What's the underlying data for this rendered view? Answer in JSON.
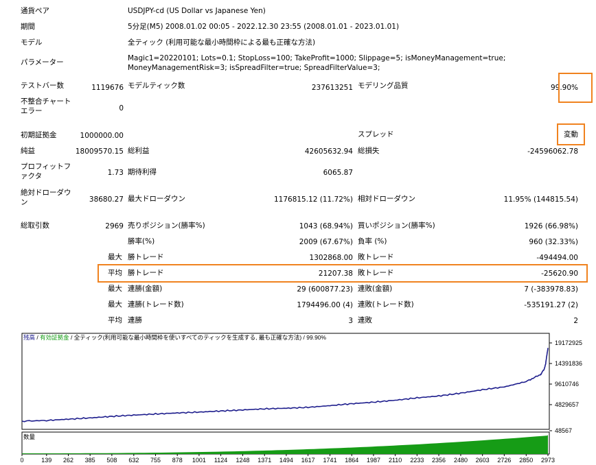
{
  "report": {
    "symbol_label": "通貨ペア",
    "symbol_value": "USDJPY-cd (US Dollar vs Japanese Yen)",
    "period_label": "期間",
    "period_value": "5分足(M5) 2008.01.02 00:05 - 2022.12.30 23:55 (2008.01.01 - 2023.01.01)",
    "model_label": "モデル",
    "model_value": "全ティック (利用可能な最小時間枠による最も正確な方法)",
    "params_label": "パラメーター",
    "params_value": "Magic1=20220101; Lots=0.1; StopLoss=100; TakeProfit=1000; Slippage=5; isMoneyManagement=true; MoneyManagementRisk=3; isSpreadFilter=true; SpreadFilterValue=3;",
    "bars_label": "テストバー数",
    "bars_value": "1119676",
    "ticks_label": "モデルティック数",
    "ticks_value": "237613251",
    "quality_label": "モデリング品質",
    "quality_value": "99.90%",
    "mismatch_label": "不整合チャートエラー",
    "mismatch_value": "0",
    "deposit_label": "初期証拠金",
    "deposit_value": "1000000.00",
    "spread_label": "スプレッド",
    "spread_value": "変動",
    "net_label": "純益",
    "net_value": "18009570.15",
    "gross_profit_label": "総利益",
    "gross_profit_value": "42605632.94",
    "gross_loss_label": "総損失",
    "gross_loss_value": "-24596062.78",
    "pf_label": "プロフィットファクタ",
    "pf_value": "1.73",
    "expected_label": "期待利得",
    "expected_value": "6065.87",
    "abs_dd_label": "絶対ドローダウン",
    "abs_dd_value": "38680.27",
    "max_dd_label": "最大ドローダウン",
    "max_dd_value": "1176815.12 (11.72%)",
    "rel_dd_label": "相対ドローダウン",
    "rel_dd_value": "11.95% (144815.54)",
    "trades_label": "総取引数",
    "trades_value": "2969",
    "short_label": "売りポジション(勝率%)",
    "short_value": "1043 (68.94%)",
    "long_label": "買いポジション(勝率%)",
    "long_value": "1926 (66.98%)",
    "win_label": "勝率(%)",
    "win_value": "2009 (67.67%)",
    "loss_label": "負率 (%)",
    "loss_value": "960 (32.33%)",
    "max_prefix": "最大",
    "avg_prefix": "平均",
    "largest_win_label": "勝トレード",
    "largest_win_value": "1302868.00",
    "largest_loss_label": "敗トレード",
    "largest_loss_value": "-494494.00",
    "avg_win_label": "勝トレード",
    "avg_win_value": "21207.38",
    "avg_loss_label": "敗トレード",
    "avg_loss_value": "-25620.90",
    "cons_win_amt_label": "連勝(金額)",
    "cons_win_amt_value": "29 (600877.23)",
    "cons_loss_amt_label": "連敗(金額)",
    "cons_loss_amt_value": "7 (-383978.83)",
    "cons_win_cnt_label": "連勝(トレード数)",
    "cons_win_cnt_value": "1794496.00 (4)",
    "cons_loss_cnt_label": "連敗(トレード数)",
    "cons_loss_cnt_value": "-535191.27 (2)",
    "avg_cons_win_label": "連勝",
    "avg_cons_win_value": "3",
    "avg_cons_loss_label": "連敗",
    "avg_cons_loss_value": "2"
  },
  "chart_data": {
    "type": "line",
    "legend": {
      "balance": "残高",
      "sep1": " / ",
      "equity": "有効証拠金",
      "sep2": " / ",
      "model": "全ティック(利用可能な最小時間枠を使いすべてのティックを生成する, 最も正確な方法)",
      "sep3": " / ",
      "quality": "99.90%"
    },
    "series": [
      {
        "name": "残高",
        "color": "#1c1c8c",
        "x": [
          0,
          139,
          262,
          385,
          508,
          632,
          755,
          878,
          1001,
          1124,
          1248,
          1371,
          1494,
          1617,
          1741,
          1864,
          1987,
          2110,
          2233,
          2356,
          2480,
          2603,
          2726,
          2850,
          2930,
          2950,
          2960,
          2973
        ],
        "y": [
          1000000,
          1150000,
          1450000,
          1750000,
          2100000,
          2400000,
          2650000,
          2900000,
          3100000,
          3350000,
          3600000,
          3850000,
          4000000,
          4200000,
          4600000,
          5050000,
          5400000,
          5850000,
          6400000,
          6850000,
          7500000,
          8300000,
          8950000,
          10200000,
          11800000,
          12900000,
          14300000,
          18009570
        ]
      }
    ],
    "yticks": [
      "19172925",
      "14391836",
      "9610746",
      "4829657",
      "48567"
    ],
    "ylim": [
      48567,
      19172925
    ],
    "xticks": [
      "0",
      "139",
      "262",
      "385",
      "508",
      "632",
      "755",
      "878",
      "1001",
      "1124",
      "1248",
      "1371",
      "1494",
      "1617",
      "1741",
      "1864",
      "1987",
      "2110",
      "2233",
      "2356",
      "2480",
      "2603",
      "2726",
      "2850",
      "2973"
    ],
    "xlim": [
      0,
      2973
    ],
    "volume_label": "数量",
    "volume_color": "#169c16"
  }
}
